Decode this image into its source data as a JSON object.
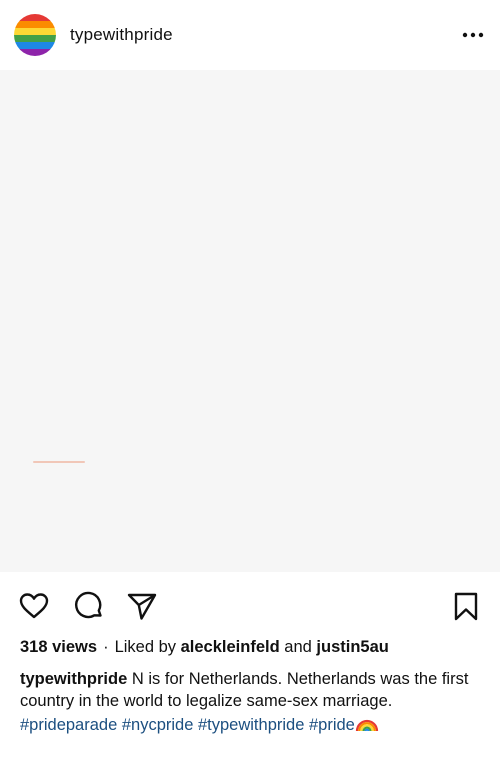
{
  "header": {
    "username": "typewithpride",
    "avatar_icon": "pride-flag-avatar",
    "more_icon": "more-options-icon"
  },
  "post": {
    "views": "318 views",
    "separator": "·",
    "liked_by_prefix": "Liked by",
    "liked_by_user1": "aleckleinfeld",
    "liked_by_and": "and",
    "liked_by_user2": "justin5au"
  },
  "caption": {
    "username": "typewithpride",
    "text": "N is for Netherlands. Netherlands was the first country in the world to legalize same-sex marriage.",
    "hashtags": [
      "#prideparade",
      "#nycpride",
      "#typewithpride",
      "#pride"
    ],
    "emoji": "rainbow-icon"
  },
  "colors": {
    "hashtag": "#1c4f80",
    "image_background": "#f6f6f6"
  }
}
